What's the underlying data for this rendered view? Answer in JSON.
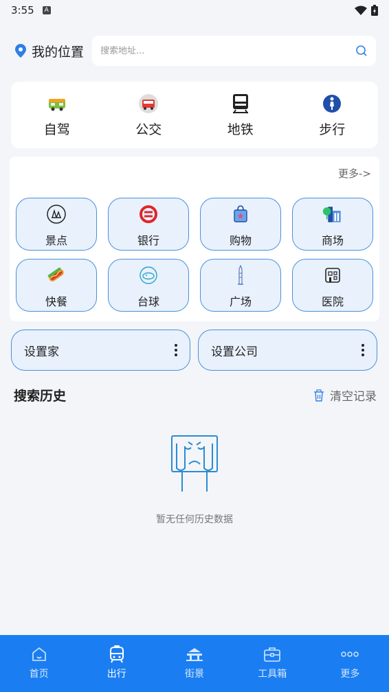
{
  "status_bar": {
    "time": "3:55",
    "notif_letter": "A"
  },
  "location": {
    "label": "我的位置",
    "search_placeholder": "搜索地址..."
  },
  "transport_modes": [
    {
      "label": "自驾",
      "icon": "car-icon"
    },
    {
      "label": "公交",
      "icon": "bus-icon"
    },
    {
      "label": "地铁",
      "icon": "subway-icon"
    },
    {
      "label": "步行",
      "icon": "walk-icon"
    }
  ],
  "poi": {
    "more": "更多->",
    "items": [
      {
        "label": "景点",
        "icon": "scenic-icon"
      },
      {
        "label": "银行",
        "icon": "bank-icon"
      },
      {
        "label": "购物",
        "icon": "shopping-icon"
      },
      {
        "label": "商场",
        "icon": "mall-icon"
      },
      {
        "label": "快餐",
        "icon": "fastfood-icon"
      },
      {
        "label": "台球",
        "icon": "billiards-icon"
      },
      {
        "label": "广场",
        "icon": "plaza-icon"
      },
      {
        "label": "医院",
        "icon": "hospital-icon"
      }
    ]
  },
  "places": {
    "home": "设置家",
    "company": "设置公司"
  },
  "history": {
    "title": "搜索历史",
    "clear": "清空记录",
    "empty": "暂无任何历史数据"
  },
  "nav": [
    {
      "label": "首页",
      "icon": "home-icon"
    },
    {
      "label": "出行",
      "icon": "travel-icon"
    },
    {
      "label": "街景",
      "icon": "streetview-icon"
    },
    {
      "label": "工具箱",
      "icon": "toolbox-icon"
    },
    {
      "label": "更多",
      "icon": "more-icon"
    }
  ],
  "colors": {
    "accent": "#1a7ef2",
    "chip_bg": "#e8f1fc",
    "chip_border": "#4a90d9",
    "page_bg": "#f3f5f9"
  }
}
